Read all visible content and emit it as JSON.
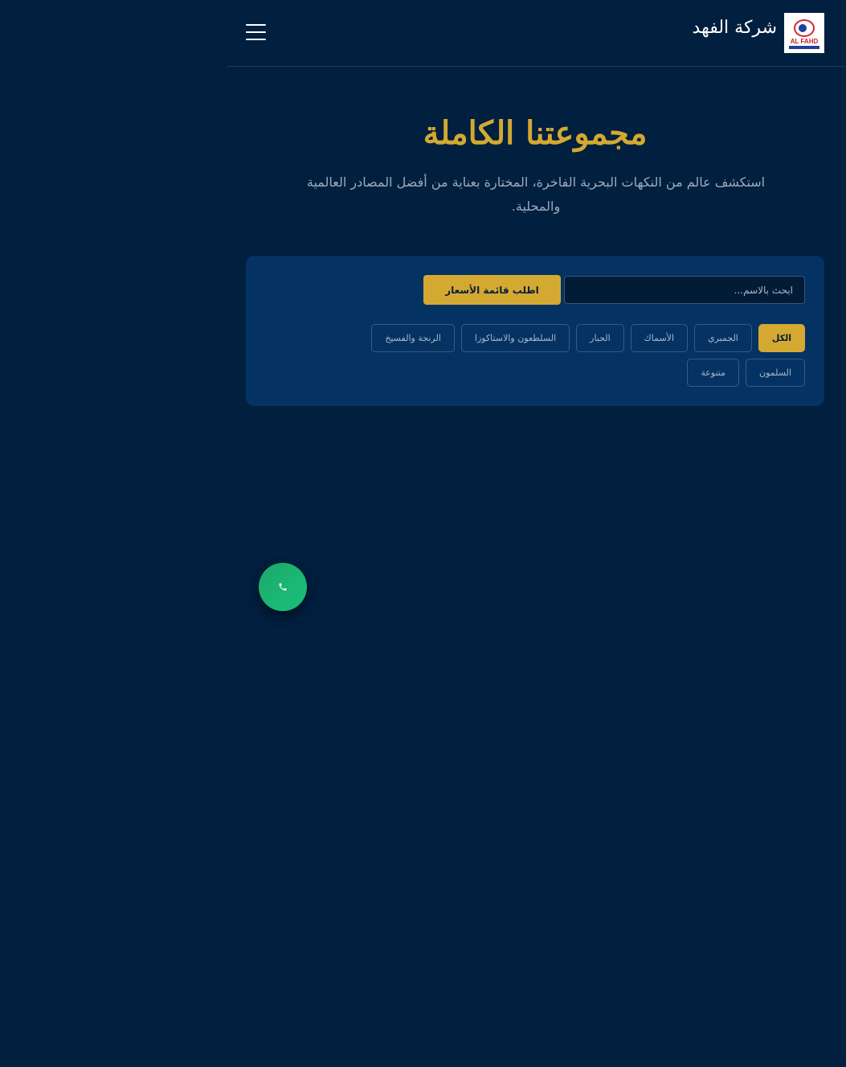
{
  "header": {
    "brand_name": "شركة الفهد",
    "logo_text": "AL FAHD",
    "menu_icon": "hamburger-icon"
  },
  "hero": {
    "title": "مجموعتنا الكاملة",
    "subtitle": "استكشف عالم من النكهات البحرية الفاخرة، المختارة بعناية من أفضل المصادر العالمية والمحلية."
  },
  "filters": {
    "search_placeholder": "ابحث بالاسم...",
    "price_button": "اطلب قائمة الأسعار",
    "categories": [
      {
        "label": "الكل",
        "active": true
      },
      {
        "label": "الجمبري",
        "active": false
      },
      {
        "label": "الأسماك",
        "active": false
      },
      {
        "label": "الحبار",
        "active": false
      },
      {
        "label": "السلطعون والاستاكوزا",
        "active": false
      },
      {
        "label": "الرنجة والفسيخ",
        "active": false
      },
      {
        "label": "السلمون",
        "active": false
      },
      {
        "label": "متنوعة",
        "active": false
      }
    ]
  },
  "floating": {
    "call_icon": "phone-icon"
  },
  "colors": {
    "background": "#011f3e",
    "panel": "#033263",
    "accent_gold": "#d4a932",
    "call_green": "#1ea86a"
  }
}
